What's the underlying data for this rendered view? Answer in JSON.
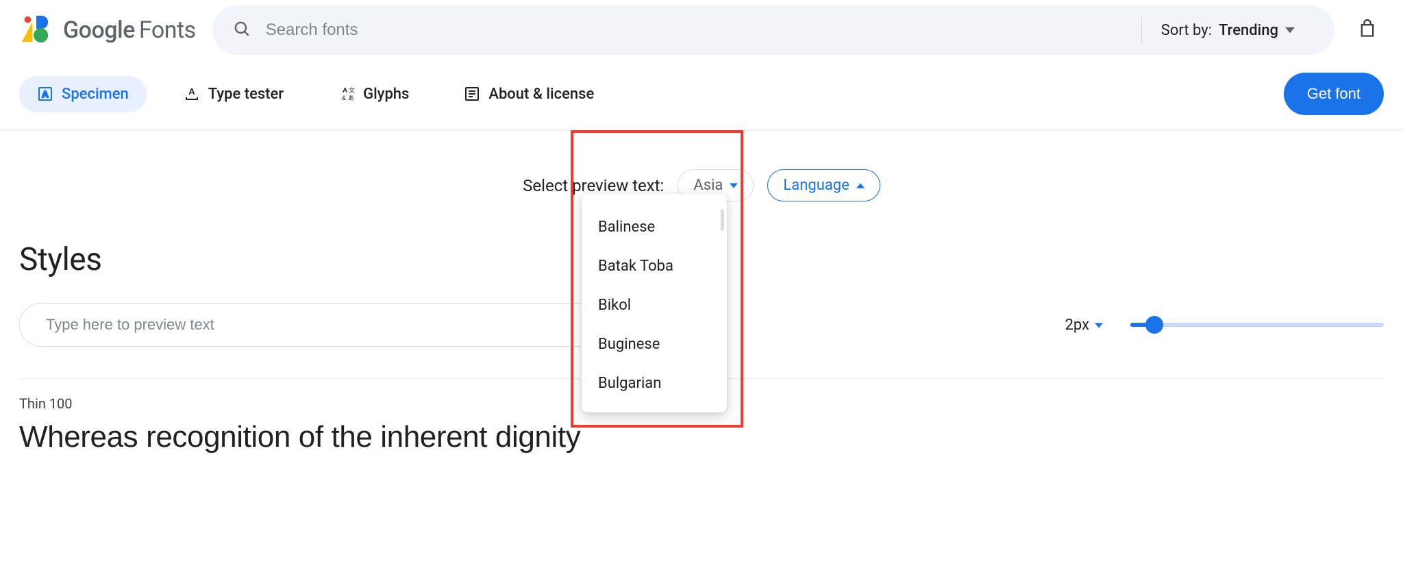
{
  "header": {
    "brand_main": "Google",
    "brand_sub": "Fonts",
    "search_placeholder": "Search fonts",
    "sort_label": "Sort by:",
    "sort_value": "Trending"
  },
  "tabs": {
    "specimen": "Specimen",
    "type_tester": "Type tester",
    "glyphs": "Glyphs",
    "about": "About & license",
    "get_font": "Get font"
  },
  "preview": {
    "select_label": "Select preview text:",
    "region_value": "Asia",
    "language_label": "Language",
    "dropdown_items": [
      "Balinese",
      "Batak Toba",
      "Bikol",
      "Buginese",
      "Bulgarian"
    ]
  },
  "styles": {
    "heading": "Styles",
    "preview_placeholder": "Type here to preview text",
    "font_size_value": "2px",
    "weight_label": "Thin 100",
    "sample_text": "Whereas recognition of the inherent dignity"
  }
}
